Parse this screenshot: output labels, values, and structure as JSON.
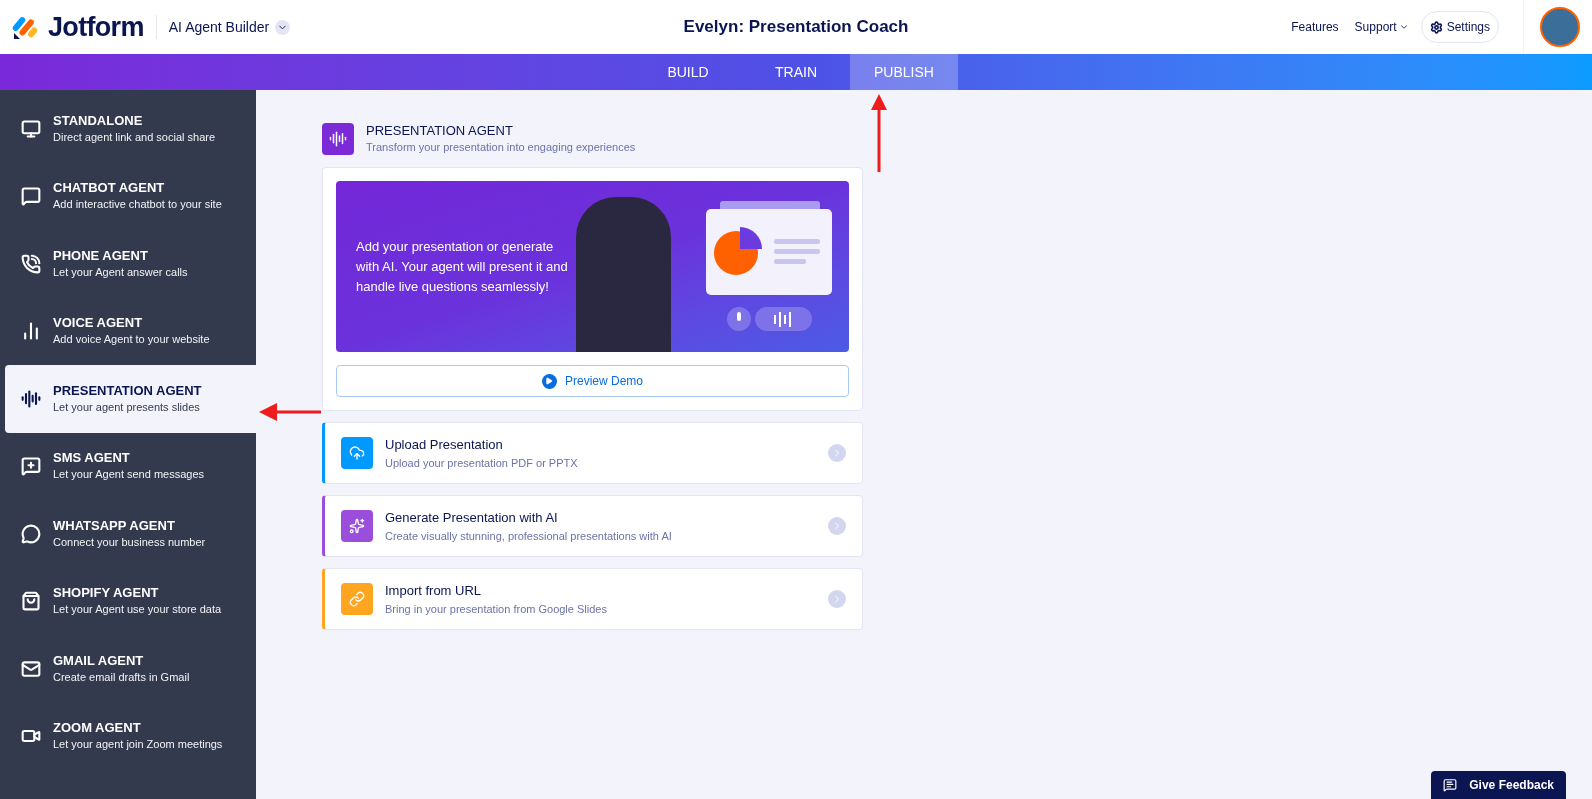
{
  "header": {
    "brand": "Jotform",
    "product": "AI Agent Builder",
    "title": "Evelyn: Presentation Coach",
    "links": [
      "Features",
      "Support"
    ],
    "settings": "Settings"
  },
  "tabs": [
    {
      "label": "BUILD",
      "selected": false
    },
    {
      "label": "TRAIN",
      "selected": false
    },
    {
      "label": "PUBLISH",
      "selected": true
    }
  ],
  "sidebar": {
    "items": [
      {
        "title": "STANDALONE",
        "subtitle": "Direct agent link and social share",
        "selected": false
      },
      {
        "title": "CHATBOT AGENT",
        "subtitle": "Add interactive chatbot to your site",
        "selected": false
      },
      {
        "title": "PHONE AGENT",
        "subtitle": "Let your Agent answer calls",
        "selected": false
      },
      {
        "title": "VOICE AGENT",
        "subtitle": "Add voice Agent to your website",
        "selected": false
      },
      {
        "title": "PRESENTATION AGENT",
        "subtitle": "Let your agent presents slides",
        "selected": true
      },
      {
        "title": "SMS AGENT",
        "subtitle": "Let your Agent send messages",
        "selected": false
      },
      {
        "title": "WHATSAPP AGENT",
        "subtitle": "Connect your business number",
        "selected": false
      },
      {
        "title": "SHOPIFY AGENT",
        "subtitle": "Let your Agent use your store data",
        "selected": false
      },
      {
        "title": "GMAIL AGENT",
        "subtitle": "Create email drafts in Gmail",
        "selected": false
      },
      {
        "title": "ZOOM AGENT",
        "subtitle": "Let your agent join Zoom meetings",
        "selected": false
      }
    ]
  },
  "section": {
    "title": "PRESENTATION AGENT",
    "subtitle": "Transform your presentation into engaging experiences"
  },
  "banner": {
    "text": "Add your presentation or generate with AI. Your agent will present it and handle live questions seamlessly!",
    "button": "Preview Demo"
  },
  "options": [
    {
      "title": "Upload Presentation",
      "subtitle": "Upload your presentation PDF or PPTX",
      "color": "#0099ff"
    },
    {
      "title": "Generate Presentation with AI",
      "subtitle": "Create visually stunning, professional presentations with AI",
      "color": "#9b4ddb"
    },
    {
      "title": "Import from URL",
      "subtitle": "Bring in your presentation from Google Slides",
      "color": "#ffa51f"
    }
  ],
  "feedback": "Give Feedback"
}
